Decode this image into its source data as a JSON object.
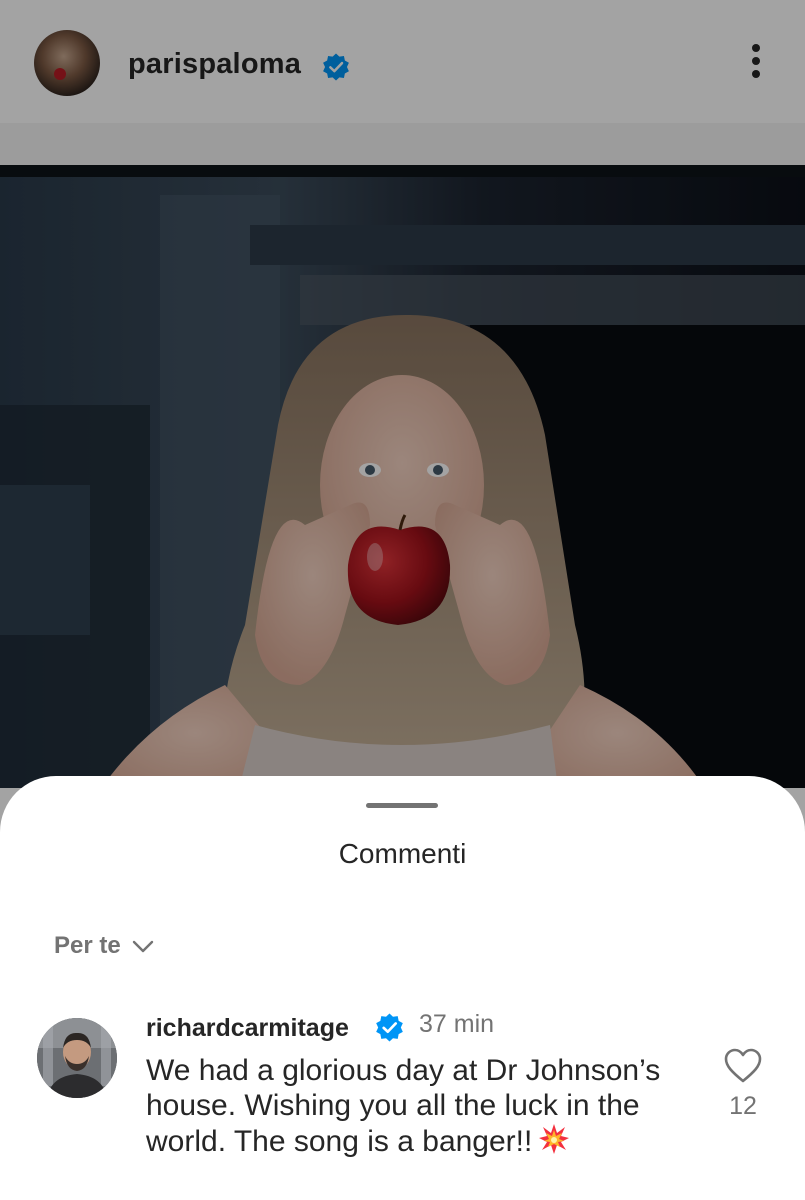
{
  "post": {
    "username": "parispaloma",
    "verified": true,
    "more_icon": "more-vertical-icon"
  },
  "sheet": {
    "title": "Commenti",
    "sort_label": "Per te"
  },
  "comment": {
    "username": "richardcarmitage",
    "verified": true,
    "time": "37 min",
    "text": "We had a glorious day at Dr Johnson’s house. Wishing you all the luck in the world. The song is a banger!!",
    "emoji_icon": "collision-burst-icon",
    "like_count": "12"
  },
  "colors": {
    "verified_blue": "#0095f6",
    "text_primary": "#262626",
    "text_secondary": "#737373",
    "apple_red": "#b81c24"
  }
}
